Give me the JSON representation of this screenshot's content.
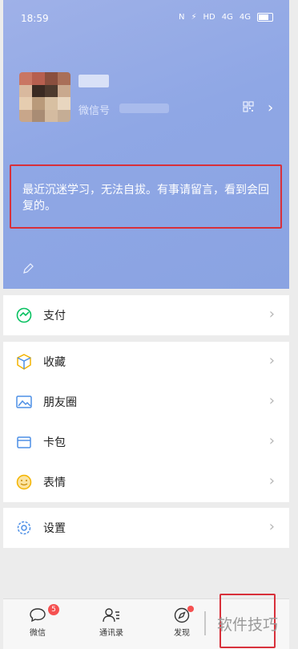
{
  "status_bar": {
    "time": "18:59",
    "icons": [
      "N",
      "⚡",
      "HD",
      "4G",
      "4G"
    ]
  },
  "profile": {
    "wechat_id_label": "微信号",
    "signature": "最近沉迷学习，无法自拔。有事请留言，看到会回复的。"
  },
  "menu": {
    "pay": "支付",
    "favorites": "收藏",
    "moments": "朋友圈",
    "cards": "卡包",
    "stickers": "表情",
    "settings": "设置"
  },
  "tabs": {
    "chats": "微信",
    "chats_badge": "5",
    "contacts": "通讯录",
    "discover": "发现"
  },
  "watermark": "软件技巧",
  "colors": {
    "accent_green": "#07c160",
    "header_blue": "#8fa7e5",
    "badge_red": "#f55151",
    "highlight_red": "#d8303a"
  }
}
